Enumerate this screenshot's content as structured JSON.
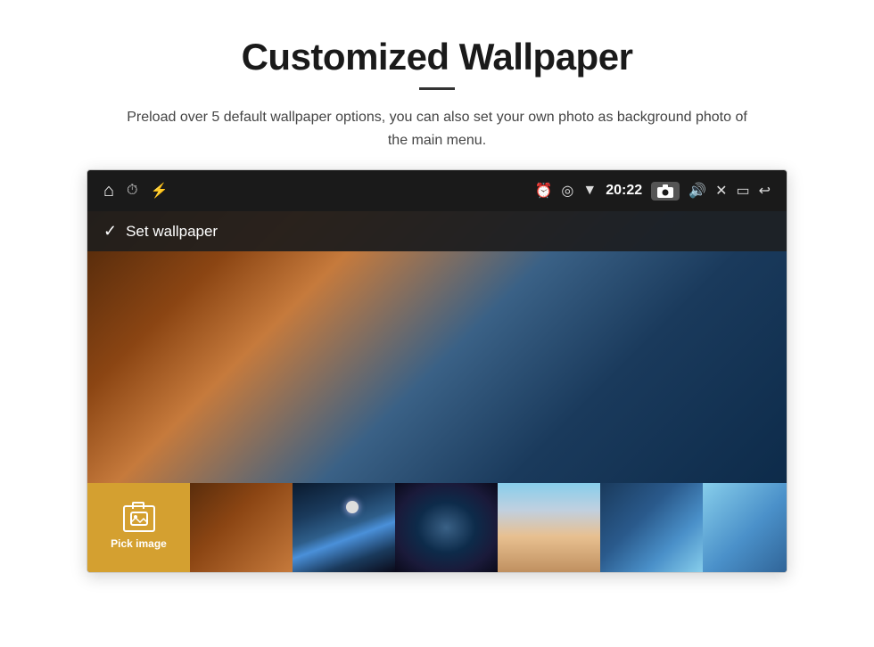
{
  "page": {
    "title": "Customized Wallpaper",
    "subtitle": "Preload over 5 default wallpaper options, you can also set your own photo as background photo of the main menu."
  },
  "statusbar": {
    "time": "20:22",
    "icons": {
      "home": "⌂",
      "alarm": "⏰",
      "usb": "⚡",
      "clock": "⏱",
      "location": "📍",
      "wifi": "▼",
      "camera": "📷",
      "volume": "🔊",
      "close": "✕",
      "window": "▭",
      "back": "↩"
    }
  },
  "set_wallpaper": {
    "checkmark": "✓",
    "label": "Set wallpaper"
  },
  "pick_image": {
    "label": "Pick image"
  }
}
